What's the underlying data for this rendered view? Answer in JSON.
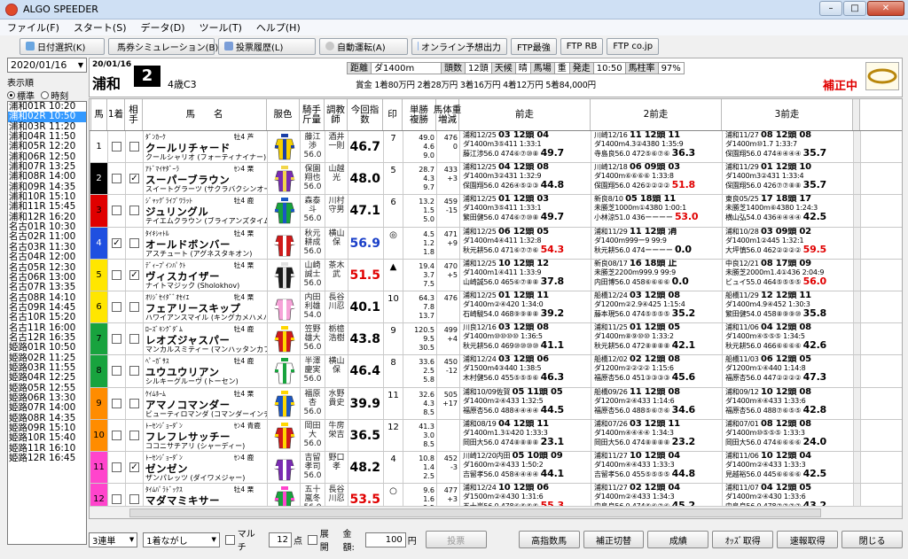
{
  "window": {
    "title": "ALGO SPEEDER"
  },
  "menu": [
    "ファイル(F)",
    "スタート(S)",
    "データ(D)",
    "ツール(T)",
    "ヘルプ(H)"
  ],
  "toolbar": [
    "日付選択(K)",
    "馬券シミュレーション(B)",
    "投票履歴(L)",
    "自動運転(A)",
    "オンライン予想出力",
    "FTP最強",
    "FTP RB",
    "FTP co.jp"
  ],
  "left": {
    "date": "2020/01/16",
    "sort_label": "表示順",
    "sort_std": "標準",
    "sort_time": "時刻",
    "races": [
      "浦和01R 10:20",
      "浦和02R 10:50",
      "浦和03R 11:20",
      "浦和04R 11:50",
      "浦和05R 12:20",
      "浦和06R 12:50",
      "浦和07R 13:25",
      "浦和08R 14:00",
      "浦和09R 14:35",
      "浦和10R 15:10",
      "浦和11R 15:45",
      "浦和12R 16:20",
      "名古01R 10:30",
      "名古02R 11:00",
      "名古03R 11:30",
      "名古04R 12:00",
      "名古05R 12:30",
      "名古06R 13:00",
      "名古07R 13:35",
      "名古08R 14:10",
      "名古09R 14:45",
      "名古10R 15:20",
      "名古11R 16:00",
      "名古12R 16:35",
      "姫路01R 10:50",
      "姫路02R 11:25",
      "姫路03R 11:55",
      "姫路04R 12:25",
      "姫路05R 12:55",
      "姫路06R 13:30",
      "姫路07R 14:00",
      "姫路08R 14:35",
      "姫路09R 15:10",
      "姫路10R 15:40",
      "姫路11R 16:10",
      "姫路12R 16:45"
    ],
    "selected": 1
  },
  "race": {
    "date": "20/01/16",
    "track": "浦和",
    "number": "2",
    "cls": "4歳C3",
    "dist_l": "距離",
    "dist": "ダ1400m",
    "heads_l": "頭数",
    "heads": "12頭",
    "weather_l": "天候",
    "weather": "晴",
    "baba_l": "馬場",
    "baba": "重",
    "start_l": "発走",
    "start": "10:50",
    "rate_l": "馬柱率",
    "rate": "97%",
    "prize": "賞金 1着80万円 2着28万円 3着16万円 4着12万円 5着84,000円",
    "hosei": "補正中"
  },
  "columns": {
    "uma": "馬",
    "c1": "1着",
    "c2": "相手",
    "name": "馬　　名",
    "silk": "服色",
    "jockey": "騎手\n斤量",
    "trainer": "調教\n師",
    "index": "今回指数",
    "mark": "印",
    "odds": "単勝\n複勝",
    "weight": "馬体重\n増減",
    "p1": "前走",
    "p2": "2前走",
    "p3": "3前走"
  },
  "horses": [
    {
      "waku": 1,
      "wc": "#ffffff",
      "n": "1",
      "c1": false,
      "c2": false,
      "sire": "ﾀﾞﾝｶｰｸ",
      "sex": "牡4 芦",
      "name": "クールリチャード",
      "dam": "クールシャリオ (フォーティナイナー)",
      "jk": "藤江\n渉\n56.0",
      "tr": "酒井\n一則",
      "ix": "46.7",
      "ixc": "#000",
      "mk": "7",
      "od": "49.0\n4.6\n9.0",
      "wt": "476\n0",
      "silk": [
        "#f4d000",
        "#1a3fa8"
      ],
      "p1": [
        "浦和12/25",
        "03 12頭 04",
        "ダ1400m3⑤411 1:33:1",
        "藤江渉56.0 474⑥⑦⑩⑧",
        "49.7"
      ],
      "p2": [
        "川崎12/16",
        "11 12頭 11",
        "ダ1400m4.3②4380 1:35:9",
        "寺島良56.0 472⑤⑥⑦⑥",
        "36.3"
      ],
      "p3": [
        "浦和11/27",
        "08 12頭 08",
        "ダ1400m⑩1.7 1:33:7",
        "保園翔56.0 474④④④④",
        "35.7"
      ]
    },
    {
      "waku": 2,
      "wc": "#000000",
      "n": "2",
      "c1": false,
      "c2": true,
      "sire": "ｱﾄﾞﾏｲﾔﾀﾞｰﾗ",
      "sex": "ｾﾝ4 栗",
      "name": "スーパーブラウン",
      "dam": "スイートグラーツ (サクラバクシンオー)",
      "jk": "保園\n翔也\n56.0",
      "tr": "山越\n光",
      "ix": "48.0",
      "ixc": "#000",
      "mk": "5",
      "od": "28.7\n4.3\n9.7",
      "wt": "433\n+3",
      "silk": [
        "#7a2bb3",
        "#f2d64a"
      ],
      "p1": [
        "浦和12/25",
        "04 12頭 08",
        "ダ1400m3②431 1:32:9",
        "保園翔56.0 426④⑤②③",
        "44.8"
      ],
      "p2": [
        "川崎12/18",
        "06 09頭 03",
        "ダ1400m⑥⑥⑥⑥ 1:33:8",
        "保園翔56.0 426②②②②",
        "51.8"
      ],
      "p3": [
        "浦和11/29",
        "01 12頭 10",
        "ダ1400m3②431 1:33:4",
        "保園翔56.0 426⑦⑦⑧⑧",
        "35.7"
      ]
    },
    {
      "waku": 3,
      "wc": "#e00000",
      "n": "3",
      "c1": false,
      "c2": false,
      "sire": "ｼﾞｬｯｸﾞﾗｲﾌﾞﾜﾗｯﾄ",
      "sex": "牡4 鹿",
      "name": "ジュリングル",
      "dam": "テイエムクラウン (ブライアンズタイム)",
      "jk": "森泰\n斗\n56.0",
      "tr": "川村\n守男",
      "ix": "47.1",
      "ixc": "#000",
      "mk": "6",
      "od": "13.2\n1.5\n5.0",
      "wt": "459\n-15",
      "silk": [
        "#18a33e",
        "#1b57c4"
      ],
      "p1": [
        "浦和12/25",
        "01 12頭 03",
        "ダ1400m3⑤411 1:33:1",
        "繁田健56.0 474⑥⑦⑩⑧",
        "49.7"
      ],
      "p2": [
        "新良8/10",
        "05 18頭 11",
        "未勝芝1000m①4380 1:00:1",
        "小林涼51.0 436ーーーー",
        "53.0"
      ],
      "p3": [
        "東良05/25",
        "17 18頭 17",
        "未勝芝1400m⑥4380 1:24:3",
        "横山弘54.0 436④④④④",
        "42.5"
      ]
    },
    {
      "waku": 4,
      "wc": "#1f4fe0",
      "n": "4",
      "c1": true,
      "c2": false,
      "sire": "ﾀｲｷｼｬﾄﾙ",
      "sex": "牡4 栗",
      "name": "オールドボンバー",
      "dam": "アスチュート (アグネスタキオン)",
      "jk": "秋元\n耕成\n56.0",
      "tr": "横山\n保",
      "ix": "56.9",
      "ixc": "#1a3fc8",
      "mk": "◎",
      "od": "4.5\n1.2\n1.8",
      "wt": "471\n+9",
      "silk": [
        "#d01a1a",
        "#ffffff"
      ],
      "p1": [
        "浦和12/25",
        "06 12頭 05",
        "ダ1400m4④411 1:32:8",
        "秋元耕56.0 471⑥⑦⑦⑥",
        "54.3"
      ],
      "p2": [
        "浦和11/29",
        "11 12頭 消",
        "ダ1400m999ー9 99:9",
        "秋元耕56.0 474ーーーー",
        "0.0"
      ],
      "p3": [
        "浦和10/28",
        "03 09頭 02",
        "ダ1400m1②445 1:32:1",
        "大坪慎56.0 462②②②②",
        "59.5"
      ]
    },
    {
      "waku": 5,
      "wc": "#ffe600",
      "n": "5",
      "c1": false,
      "c2": true,
      "sire": "ﾃﾞｨｰﾌﾟｲﾝﾊﾟｸﾄ",
      "sex": "牡4 栗",
      "name": "ヴィスカイザー",
      "dam": "ナイトマジック (Sholokhov)",
      "jk": "山崎\n誠士\n56.0",
      "tr": "茶木\n武",
      "ix": "51.5",
      "ixc": "#e00000",
      "mk": "▲",
      "od": "19.4\n3.7\n7.5",
      "wt": "470\n+5",
      "silk": [
        "#1a1a1a",
        "#e0e0e0"
      ],
      "p1": [
        "浦和12/25",
        "10 12頭 12",
        "ダ1400m1④411 1:33:9",
        "山崎誠56.0 465⑥⑦⑧⑧",
        "37.8"
      ],
      "p2": [
        "新良08/17",
        "16 18頭 止",
        "未勝芝2200m999.9 99:9",
        "内田博56.0 458⑥⑥⑥⑥",
        "0.0"
      ],
      "p3": [
        "中良12/21",
        "08 17頭 09",
        "未勝芝2000m1.4①436 2:04:9",
        "ビュイ55.0 464⑤⑤⑤⑤",
        "56.0"
      ]
    },
    {
      "waku": 5,
      "wc": "#ffe600",
      "n": "6",
      "c1": false,
      "c2": false,
      "sire": "ｵﾘｼﾞｾｲﾀﾞﾞｵｾｲｴ",
      "sex": "牝4 栗",
      "name": "フェアリースキップ",
      "dam": "ハワイアンスマイル (キングカメハメハ)",
      "jk": "内田\n利雄\n54.0",
      "tr": "長谷\n川忍",
      "ix": "40.1",
      "ixc": "#000",
      "mk": "10",
      "od": "64.3\n7.8\n13.7",
      "wt": "476\n",
      "silk": [
        "#f6a3d8",
        "#ffffff"
      ],
      "p1": [
        "浦和12/25",
        "01 12頭 11",
        "ダ1400m②④420 1:34:0",
        "石崎駿54.0 468⑨⑨⑧⑧",
        "39.2"
      ],
      "p2": [
        "船橋12/24",
        "03 12頭 08",
        "ダ1200m②2.9④425 1:15:4",
        "藤本現56.0 474⑤⑤⑤⑤",
        "35.2"
      ],
      "p3": [
        "船橋11/29",
        "12 12頭 11",
        "ダ1400m4.9④452 1:30:3",
        "繁田健54.0 458⑧⑨⑨⑩",
        "35.8"
      ]
    },
    {
      "waku": 6,
      "wc": "#18a33e",
      "n": "7",
      "c1": false,
      "c2": false,
      "sire": "ﾛｰｽﾞｷﾝｸﾞﾀﾞﾑ",
      "sex": "牡4 鹿",
      "name": "レオズジャスパー",
      "dam": "マンカルスミティー (マンハッタンカフェ)",
      "jk": "笠野\n雄大\n56.0",
      "tr": "栃檍\n浩樹",
      "ix": "43.8",
      "ixc": "#000",
      "mk": "9",
      "od": "120.5\n9.5\n30.5",
      "wt": "499\n+4",
      "silk": [
        "#d01a1a",
        "#ffd700"
      ],
      "p1": [
        "川良12/16",
        "03 12頭 08",
        "ダ1400m⑩⑩⑩⑩ 1:36:5",
        "秋元耕56.0 469⑩⑩⑩⑩",
        "41.1"
      ],
      "p2": [
        "浦和11/25",
        "01 12頭 05",
        "ダ1400m⑧⑨⑩⑩ 1:33:2",
        "秋元耕56.0 472⑧⑧⑧⑧",
        "42.1"
      ],
      "p3": [
        "浦和11/06",
        "04 12頭 08",
        "ダ1400m④⑤⑤⑤ 1:34:5",
        "秋元耕56.0 466⑥⑥⑥⑥",
        "42.6"
      ]
    },
    {
      "waku": 6,
      "wc": "#18a33e",
      "n": "8",
      "c1": false,
      "c2": false,
      "sire": "ﾍﾟｰｶﾞｻｽ",
      "sex": "牡4 鹿",
      "name": "ユウユウリアン",
      "dam": "シルキーグルーヴ (トーセン)",
      "jk": "半澤\n慶実\n56.0",
      "tr": "横山\n保",
      "ix": "46.4",
      "ixc": "#000",
      "mk": "8",
      "od": "33.6\n2.5\n5.8",
      "wt": "450\n-12",
      "silk": [
        "#ffffff",
        "#18a33e"
      ],
      "p1": [
        "浦和12/24",
        "03 12頭 06",
        "ダ1500m4③440 1:38:5",
        "木村健56.0 455⑤⑤⑤⑥",
        "46.3"
      ],
      "p2": [
        "船橋12/02",
        "02 12頭 08",
        "ダ1200m②②②② 1:15:6",
        "福原杏56.0 451③③③③",
        "45.6"
      ],
      "p3": [
        "船橋11/03",
        "06 12頭 05",
        "ダ1200m①④440 1:14:8",
        "福原杏56.0 447②②②②",
        "47.3"
      ]
    },
    {
      "waku": 7,
      "wc": "#ff8c00",
      "n": "9",
      "c1": false,
      "c2": false,
      "sire": "ｹｲﾑﾎｰﾑ",
      "sex": "牡4 栗",
      "name": "アマノコマンダー",
      "dam": "ビューティロマンダ (コマンダーインチーフ)",
      "jk": "福原\n杏\n56.0",
      "tr": "水野\n貴史",
      "ix": "39.9",
      "ixc": "#000",
      "mk": "11",
      "od": "32.6\n4.3\n8.5",
      "wt": "505\n+17",
      "silk": [
        "#1b57c4",
        "#ffd700"
      ],
      "p1": [
        "浦和10/09佐賀",
        "05 11頭 05",
        "ダ1400m②④433 1:32:5",
        "福原杏56.0 488④④④④",
        "44.5"
      ],
      "p2": [
        "船橋09/26",
        "11 12頭 08",
        "ダ1200m②④433 1:14:6",
        "福原杏56.0 488⑤⑥⑦⑥",
        "34.6"
      ],
      "p3": [
        "浦和09/12",
        "10 12頭 08",
        "ダ1400m④④433 1:33:6",
        "福原杏56.0 488⑦⑥⑤⑤",
        "42.8"
      ]
    },
    {
      "waku": 7,
      "wc": "#ff8c00",
      "n": "10",
      "c1": false,
      "c2": false,
      "sire": "ﾄｰｾﾝｼﾞｮｰﾀﾞﾝ",
      "sex": "ｾﾝ4 青鹿",
      "name": "フレフレサッチー",
      "dam": "ココニサチアリ (シャーディー)",
      "jk": "岡田\n大\n56.0",
      "tr": "牛房\n栄吉",
      "ix": "36.5",
      "ixc": "#000",
      "mk": "12",
      "od": "41.3\n3.0\n8.5",
      "wt": "",
      "silk": [
        "#d01a1a",
        "#ffd700"
      ],
      "p1": [
        "浦和08/19",
        "04 12頭 11",
        "ダ1400m1.3①420 1:33:3",
        "岡田大56.0 474⑧⑧⑧⑧",
        "23.1"
      ],
      "p2": [
        "浦和07/26",
        "03 12頭 11",
        "ダ1400m④④④④ 1:34:3",
        "岡田大56.0 474⑧⑧⑧⑧",
        "23.2"
      ],
      "p3": [
        "浦和07/01",
        "08 12頭 08",
        "ダ1400m⑩⑤⑤⑤ 1:33:3",
        "岡田大56.0 474⑥⑥⑥⑥",
        "24.0"
      ]
    },
    {
      "waku": 8,
      "wc": "#ff44cc",
      "n": "11",
      "c1": false,
      "c2": true,
      "sire": "ﾄｰｾﾝｼﾞｮｰﾀﾞﾝ",
      "sex": "ｾﾝ4 鹿",
      "name": "ゼンゼン",
      "dam": "ザンパレッツ (ダイワメジャー)",
      "jk": "吉留\n孝司\n56.0",
      "tr": "野口\n孝",
      "ix": "48.2",
      "ixc": "#000",
      "mk": "4",
      "od": "10.8\n1.4\n2.5",
      "wt": "452\n-3",
      "silk": [
        "#7a2bb3",
        "#ffffff"
      ],
      "p1": [
        "川崎12/20内田",
        "05 10頭 09",
        "ダ1600m②④433 1:50:2",
        "吉留孝56.0 458④④④④",
        "44.1"
      ],
      "p2": [
        "浦和11/27",
        "10 12頭 04",
        "ダ1400m④④433 1:33:3",
        "吉留孝56.0 455⑤⑤⑤⑤",
        "44.8"
      ],
      "p3": [
        "浦和11/06",
        "10 12頭 04",
        "ダ1400m②④433 1:33:3",
        "見越裕56.0 445⑥⑥⑥⑥",
        "42.5"
      ]
    },
    {
      "waku": 8,
      "wc": "#ff44cc",
      "n": "12",
      "c1": false,
      "c2": false,
      "sire": "ﾀｲﾑﾊﾟﾗﾄﾞｯｸｽ",
      "sex": "牡4 栗",
      "name": "マダマミキサー",
      "dam": "ヤマショウキ (アブリート)",
      "jk": "五十\n嵐冬\n56.0",
      "tr": "長谷\n川忍",
      "ix": "53.5",
      "ixc": "#e00000",
      "mk": "○",
      "od": "9.6\n1.6\n2.5",
      "wt": "477\n+3",
      "silk": [
        "#18a33e",
        "#ff44cc"
      ],
      "p1": [
        "浦和12/24",
        "10 12頭 06",
        "ダ1500m②④430 1:31:6",
        "五十嵐56.0 478⑥⑤⑤⑤",
        "55.3"
      ],
      "p2": [
        "浦和11/27",
        "02 12頭 04",
        "ダ1400m②④433 1:34:3",
        "中島良56.0 474⑤⑥⑦⑥",
        "45.2"
      ],
      "p3": [
        "浦和11/07",
        "04 12頭 05",
        "ダ1400m②④430 1:33:6",
        "中島良56.0 478⑦⑦⑦⑦",
        "43.2"
      ]
    }
  ],
  "bottom": {
    "bet": "3連単",
    "nagashi": "1着ながし",
    "multi": "マルチ",
    "count": "12",
    "count_unit": "点",
    "tenkai": "展開",
    "kingaku_l": "金額:",
    "kingaku": "100",
    "yen": "円",
    "vote": "投票",
    "kousou": "高指数馬",
    "hosei": "補正切替",
    "seiseki": "成績",
    "odds": "ｵｯｽﾞ取得",
    "sokuho": "速報取得",
    "close": "閉じる"
  }
}
